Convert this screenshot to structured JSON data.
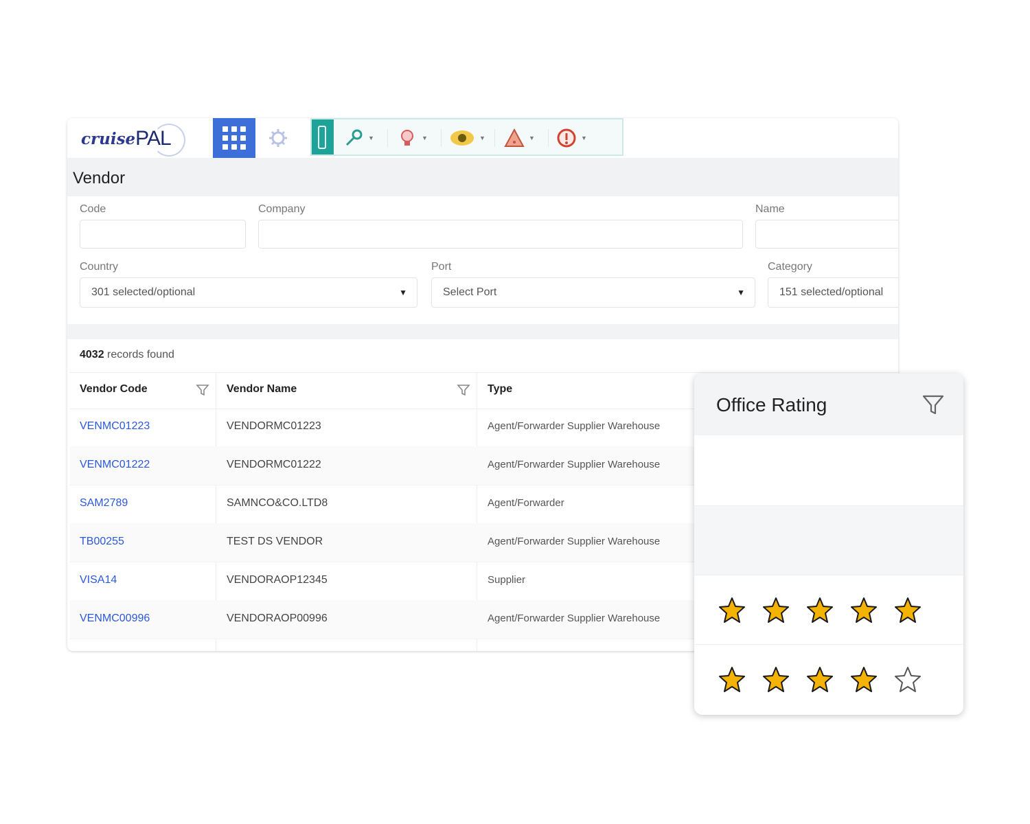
{
  "app": {
    "logo": {
      "part1": "cruise",
      "part2": "PAL"
    },
    "toolbar": {
      "icons": [
        "apps-grid-icon",
        "gear-icon",
        "sidebar-icon",
        "key-icon",
        "bulb-icon",
        "eye-icon",
        "alert-icon",
        "info-icon"
      ],
      "accent": "#3e6fd8",
      "teal": "#1fa29a"
    },
    "page_title": "Vendor",
    "filters": {
      "code_label": "Code",
      "company_label": "Company",
      "name_label": "Name",
      "country_label": "Country",
      "country_value": "301 selected/optional",
      "port_label": "Port",
      "port_value": "Select Port",
      "category_label": "Category",
      "category_value": "151 selected/optional"
    },
    "records": {
      "count": "4032",
      "suffix": "records found"
    },
    "table": {
      "headers": [
        "Vendor Code",
        "Vendor Name",
        "Type"
      ],
      "rows": [
        {
          "code": "VENMC01223",
          "name": "VENDORMC01223",
          "type": "Agent/Forwarder Supplier Warehouse"
        },
        {
          "code": "VENMC01222",
          "name": "VENDORMC01222",
          "type": "Agent/Forwarder Supplier Warehouse"
        },
        {
          "code": "SAM2789",
          "name": "SAMNCO&CO.LTD8",
          "type": "Agent/Forwarder"
        },
        {
          "code": "TB00255",
          "name": "TEST DS VENDOR",
          "type": "Agent/Forwarder Supplier Warehouse"
        },
        {
          "code": "VISA14",
          "name": "VENDORAOP12345",
          "type": "Supplier"
        },
        {
          "code": "VENMC00996",
          "name": "VENDORAOP00996",
          "type": "Agent/Forwarder Supplier Warehouse"
        }
      ],
      "link_color": "#2b58d8"
    }
  },
  "rating_card": {
    "title": "Office Rating",
    "ratings": [
      null,
      null,
      5,
      4
    ],
    "max_stars": 5,
    "star_color": "#f5b301"
  }
}
